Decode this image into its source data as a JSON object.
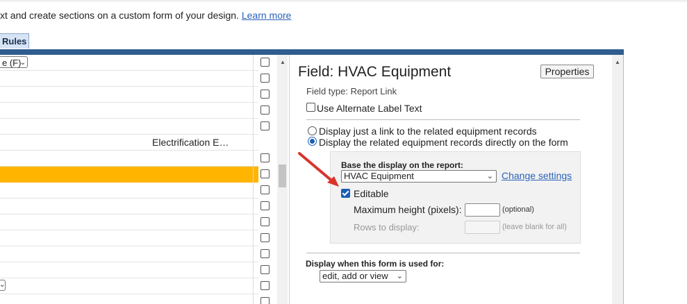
{
  "intro": {
    "text": "xt and create sections on a custom form of your design.",
    "link": "Learn more"
  },
  "tabs": {
    "rules": "Rules"
  },
  "left_list": {
    "first_select_value": "e (F)",
    "row_label": "Electrification E…",
    "colors": {
      "selected_row": "#ffb400"
    }
  },
  "field": {
    "title": "Field: HVAC Equipment",
    "properties_button": "Properties",
    "type": "Field type: Report Link",
    "alt_label_option": "Use Alternate Label Text",
    "display_options": [
      {
        "label": "Display just a link to the related equipment records",
        "selected": false
      },
      {
        "label": "Display the related equipment records directly on the form",
        "selected": true
      }
    ],
    "report_label": "Base the display on the report:",
    "report_value": "HVAC Equipment",
    "change_settings": "Change settings",
    "editable_label": "Editable",
    "editable_checked": true,
    "max_height_label": "Maximum height (pixels):",
    "max_height_value": "",
    "max_height_hint": "(optional)",
    "rows_label": "Rows to display:",
    "rows_value": "",
    "rows_hint": "(leave blank for all)",
    "display_when_label": "Display when this form is used for:",
    "display_when_value": "edit, add or view"
  },
  "colors": {
    "accent": "#2f5d8f",
    "link": "#2a62b8",
    "annotation_arrow": "#d9342b"
  },
  "icons": {
    "arrow": "red-annotation-arrow",
    "dropdown": "chevron-down-icon",
    "scroll_up": "scroll-up-icon"
  }
}
